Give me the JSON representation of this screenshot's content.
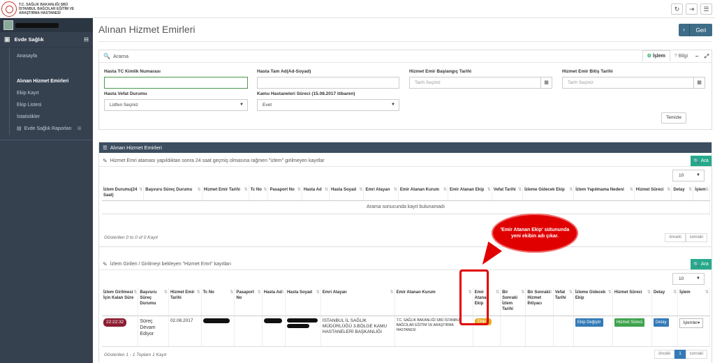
{
  "header": {
    "logo_lines": [
      "T.C. SAĞLIK BAKANLIĞI SBÜ",
      "İSTANBUL BAĞCILAR EĞİTİM VE",
      "ARAŞTIRMA HASTANESİ"
    ],
    "icons": [
      "refresh-icon",
      "logout-icon",
      "menu-icon"
    ]
  },
  "sidebar": {
    "section_title": "Evde Sağlık",
    "toggle": "⊟",
    "items": [
      {
        "label": "Anasayfa"
      },
      {
        "label": "Alınan Hizmet Emirleri",
        "active": true
      },
      {
        "label": "Ekip Kayıt"
      },
      {
        "label": "Ekip Listesi"
      },
      {
        "label": "İstatistikler"
      },
      {
        "label": "Evde Sağlık Raporları"
      }
    ]
  },
  "page": {
    "title": "Alınan Hizmet Emirleri",
    "back_label": "Geri"
  },
  "search": {
    "title": "Arama",
    "tab_active": "İşlem",
    "tab_info": "Bilgi",
    "fields": {
      "tc_label": "Hasta TC Kimlik Numarası",
      "name_label": "Hasta Tam Ad(Ad-Soyad)",
      "start_label": "Hizmet Emir Başlangıç Tarihi",
      "start_placeholder": "Tarih Seçiniz",
      "end_label": "Hizmet Emir Bitiş Tarihi",
      "end_placeholder": "Tarih Seçiniz",
      "death_label": "Hasta Vefat Durumu",
      "death_value": "Lütfen Seçiniz",
      "kamu_label": "Kamu Hastaneleri Süreci",
      "kamu_label_suffix": " (15.08.2017 itibaren)",
      "kamu_value": "Evet"
    },
    "clear_label": "Temizle"
  },
  "list": {
    "title": "Alınan Hizmet Emirleri",
    "ara_label": "Ara",
    "page_size": "10",
    "section1": {
      "title": "Hizmet Emri ataması yapıldıktan sonra 24 saat geçmiş olmasına rağmen \"izlem\" girilmeyen kayıtlar",
      "columns": [
        "İzlem Durumu(24 Saat)",
        "Başvuru Süreç Durumu",
        "Hizmet Emir Tarihi",
        "Tc No",
        "Pasaport No",
        "Hasta Ad",
        "Hasta Soyad",
        "Emri Atayan",
        "Emir Atanan Kurum",
        "Emir Atanan Ekip",
        "Vefat Tarihi",
        "İzleme Gidecek Ekip",
        "İzlem Yapılmama Nedeni",
        "Hizmet Süreci",
        "Detay",
        "İşlem"
      ],
      "empty": "Arama sonucunda kayıt bulunamadı",
      "footer": "Gösterilen 0 to 0 of 0 Kayıt",
      "prev": "önceki",
      "next": "sonraki"
    },
    "section2": {
      "title": "İzlem Girilen / Girilmeyi bekleyen \"Hizmet Emri\" kayıtları",
      "columns": [
        "İzlem Girilmesi İçin Kalan Süre",
        "Başvuru Süreç Durumu",
        "Hizmet Emir Tarihi",
        "Tc No",
        "Pasaport No",
        "Hasta Ad",
        "Hasta Soyad",
        "Emri Atayan",
        "Emir Atanan Kurum",
        "Emir Atanan Ekip",
        "Bir Sonraki İzlem Tarihi",
        "Bir Sonraki Hizmet İhtiyacı",
        "Vefat Tarihi",
        "İzleme Gidecek Ekip",
        "Hizmet Süreci",
        "Detay",
        "İşlem"
      ],
      "row": {
        "time": "22:22:32",
        "status": "Süreç Devam Ediyor",
        "date": "02.08.2017",
        "assigner": "İSTANBUL İL SAĞLIK MÜDÜRLÜĞÜ 3.BÖLGE KAMU HASTANELERİ BAŞKANLIĞI",
        "institution": "T.C. SAĞLIK BAKANLIĞI SBÜ İSTANBUL BAĞCILAR EĞİTİM VE ARAŞTIRMA HASTANESİ",
        "team": "Ekip 6",
        "change_team": "Ekip Değiştir",
        "service": "Hizmet Süreci",
        "detail": "Detay",
        "actions": "İşlemler"
      },
      "footer": "Gösterilen 1 - 1 Toplam 1 Kayıt",
      "prev": "önceki",
      "page": "1",
      "next": "sonraki"
    }
  },
  "callout": {
    "text": "'Emir Atanan Ekip' sütununda yeni ekibin adı çıkar."
  }
}
